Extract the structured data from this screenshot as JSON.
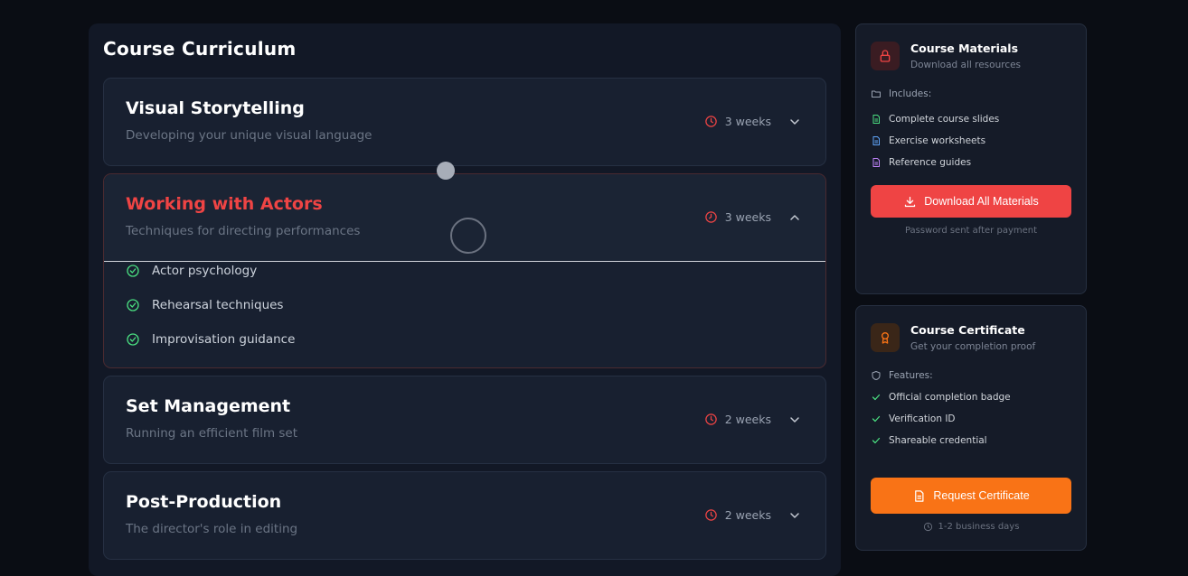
{
  "curriculum": {
    "title": "Course Curriculum",
    "modules": [
      {
        "title": "Visual Storytelling",
        "subtitle": "Developing your unique visual language",
        "duration": "3 weeks",
        "expanded": false
      },
      {
        "title": "Working with Actors",
        "subtitle": "Techniques for directing performances",
        "duration": "3 weeks",
        "expanded": true,
        "lessons": [
          "Actor psychology",
          "Rehearsal techniques",
          "Improvisation guidance"
        ]
      },
      {
        "title": "Set Management",
        "subtitle": "Running an efficient film set",
        "duration": "2 weeks",
        "expanded": false
      },
      {
        "title": "Post-Production",
        "subtitle": "The director's role in editing",
        "duration": "2 weeks",
        "expanded": false
      }
    ]
  },
  "materials": {
    "title": "Course Materials",
    "subtitle": "Download all resources",
    "includes_label": "Includes:",
    "items": [
      "Complete course slides",
      "Exercise worksheets",
      "Reference guides"
    ],
    "button_label": "Download All Materials",
    "note": "Password sent after payment",
    "icon": "lock-icon"
  },
  "certificate": {
    "title": "Course Certificate",
    "subtitle": "Get your completion proof",
    "features_label": "Features:",
    "items": [
      "Official completion badge",
      "Verification ID",
      "Shareable credential"
    ],
    "button_label": "Request Certificate",
    "note": "1-2 business days",
    "icon": "award-icon"
  },
  "colors": {
    "accent_red": "#ef4444",
    "accent_orange": "#f97316",
    "success_green": "#4ade80"
  }
}
